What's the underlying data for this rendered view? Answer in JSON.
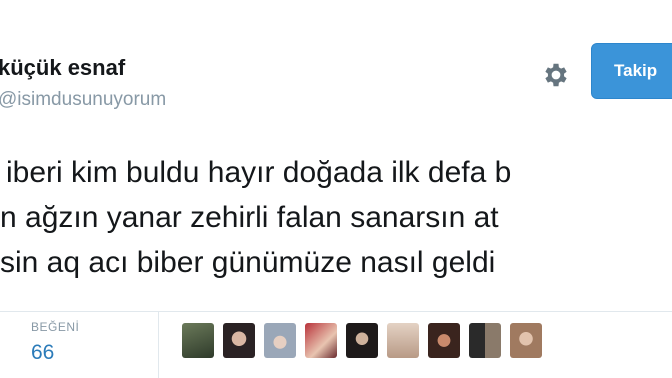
{
  "profile": {
    "name": "küçük esnaf",
    "handle": "@isimdusunuyorum"
  },
  "actions": {
    "follow_label": "Takip",
    "settings_icon": "gear-icon"
  },
  "tweet": {
    "lines": [
      "iberi kim buldu hayır doğada ilk defa b",
      "n ağzın yanar zehirli falan sanarsın at",
      "sin aq acı biber günümüze nasıl geldi"
    ]
  },
  "stats": {
    "likes_label": "BEĞENİ",
    "likes_count": "66"
  },
  "likers": {
    "avatar_count": 9
  }
}
